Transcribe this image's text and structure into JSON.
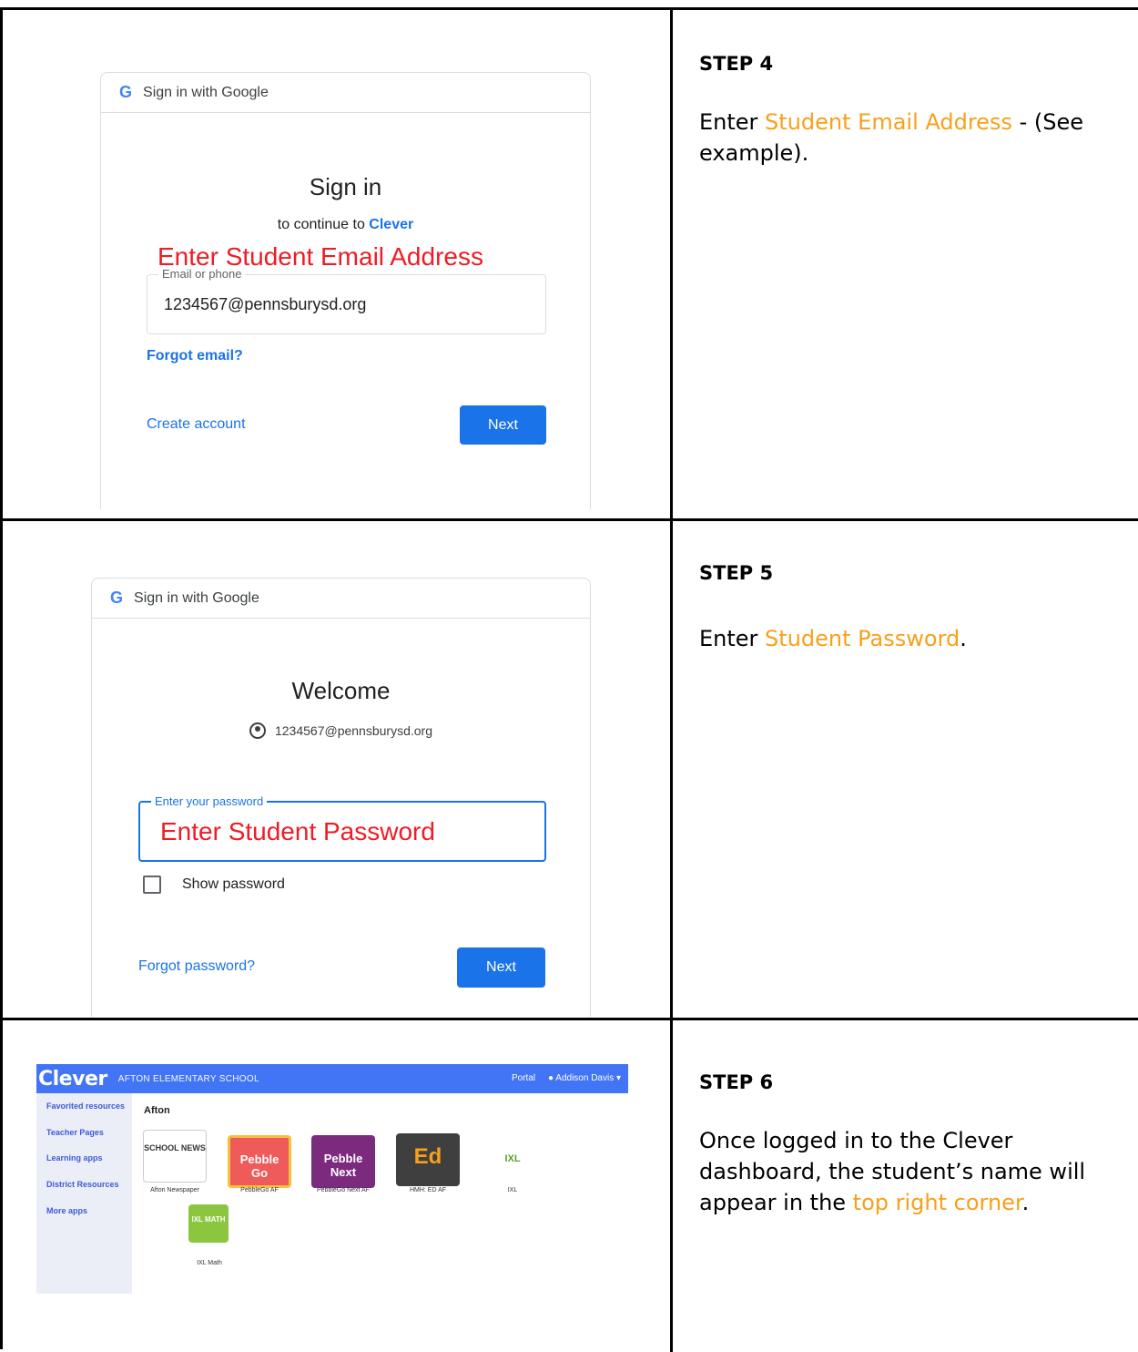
{
  "step4": {
    "title": "STEP 4",
    "text_before": "Enter ",
    "highlight": "Student Email Address",
    "text_after": " - (See example).",
    "card": {
      "header": "Sign in with Google",
      "heading": "Sign in",
      "sub_before": "to continue to ",
      "sub_link": "Clever",
      "red_note": "Enter Student Email Address",
      "field_label": "Email or phone",
      "field_value": "1234567@pennsburysd.org",
      "forgot": "Forgot email?",
      "create": "Create account",
      "next": "Next"
    }
  },
  "step5": {
    "title": "STEP 5",
    "text_before": "Enter ",
    "highlight": "Student Password",
    "text_after": ".",
    "card": {
      "header": "Sign in with Google",
      "heading": "Welcome",
      "account": "1234567@pennsburysd.org",
      "field_label": "Enter your password",
      "red_note": "Enter Student Password",
      "show_password": "Show password",
      "forgot": "Forgot password?",
      "next": "Next"
    }
  },
  "step6": {
    "title": "STEP 6",
    "text_before": "Once logged in to the Clever dashboard, the student’s name will appear in the ",
    "highlight": "top right corner",
    "text_after": ".",
    "dashboard": {
      "logo": "Clever",
      "school": "AFTON ELEMENTARY SCHOOL",
      "portal": "Portal",
      "user": "Addison Davis",
      "sidebar": [
        "Favorited resources",
        "Teacher Pages",
        "Learning apps",
        "District Resources",
        "More apps"
      ],
      "section": "Afton",
      "apps": [
        {
          "name": "Afton Newspaper",
          "tile_text": "SCHOOL NEWS",
          "color": "#ffffff"
        },
        {
          "name": "PebbleGo AF",
          "tile_text": "Pebble Go",
          "color": "#ef5a5a"
        },
        {
          "name": "PebbleGo Next AF",
          "tile_text": "Pebble Next",
          "color": "#7b2a7e"
        },
        {
          "name": "HMH: ED AF",
          "tile_text": "Ed",
          "color": "#3f3f3f"
        },
        {
          "name": "IXL",
          "tile_text": "IXL",
          "color": "#ffffff"
        },
        {
          "name": "IXL Math",
          "tile_text": "IXL MATH",
          "color": "#8cc63f"
        }
      ]
    }
  },
  "colors": {
    "highlight": "#f7a01b",
    "google_blue": "#1a73e8",
    "note_red": "#ee1c25",
    "clever_blue": "#4274f6"
  },
  "icons": {
    "google": "google-g-icon",
    "account": "account-circle-icon",
    "user": "user-icon",
    "caret": "caret-down-icon"
  }
}
